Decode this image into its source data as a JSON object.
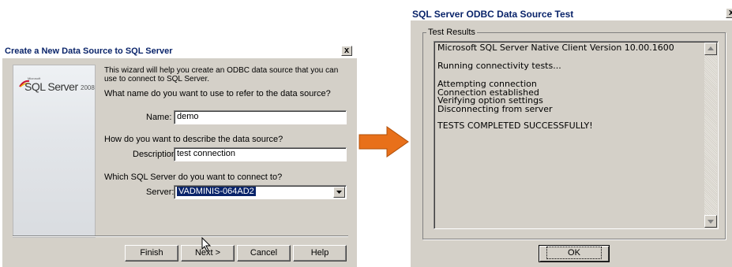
{
  "dialog1": {
    "title": "Create a New Data Source to SQL Server",
    "close": "x",
    "logo_microsoft": "Microsoft",
    "logo_sql": "SQL Server",
    "logo_year": "2008",
    "intro": "This wizard will help you create an ODBC data source that you can use to connect to SQL Server.",
    "name_question": "What name do you want to use to refer to the data source?",
    "name_label": "Name:",
    "name_value": "demo",
    "desc_question": "How do you want to describe the data source?",
    "desc_label": "Description:",
    "desc_value": "test connection",
    "server_question": "Which SQL Server do you want to connect to?",
    "server_label": "Server:",
    "server_value": "VADMINIS-064AD2",
    "buttons": {
      "finish": "Finish",
      "next": "Next >",
      "cancel": "Cancel",
      "help": "Help"
    }
  },
  "dialog2": {
    "title": "SQL Server ODBC Data Source Test",
    "close": "x",
    "group_label": "Test Results",
    "results": [
      "Microsoft SQL Server Native Client Version 10.00.1600",
      "",
      "Running connectivity tests...",
      "",
      "Attempting connection",
      "Connection established",
      "Verifying option settings",
      "Disconnecting from server",
      "",
      "TESTS COMPLETED SUCCESSFULLY!"
    ],
    "ok": "OK"
  },
  "colors": {
    "arrow": "#e8701a",
    "title_text": "#0a246a",
    "selection": "#0a246a"
  }
}
